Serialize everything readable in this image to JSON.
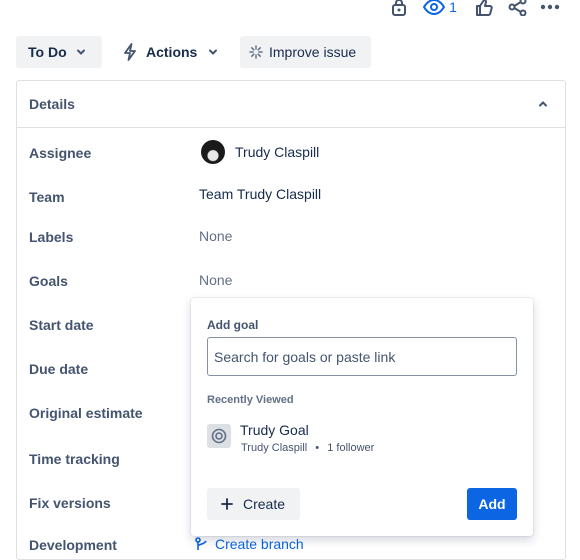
{
  "header": {
    "watch_count": "1",
    "icons": [
      "lock-icon",
      "watch-eye-icon",
      "like-icon",
      "share-icon",
      "more-icon"
    ]
  },
  "toolbar": {
    "status_label": "To Do",
    "actions_label": "Actions",
    "improve_label": "Improve issue"
  },
  "details": {
    "title": "Details",
    "fields": {
      "assignee": {
        "label": "Assignee",
        "value": "Trudy Claspill"
      },
      "team": {
        "label": "Team",
        "value": "Team Trudy Claspill"
      },
      "labels": {
        "label": "Labels",
        "value": "None"
      },
      "goals": {
        "label": "Goals",
        "value": "None"
      },
      "start_date": {
        "label": "Start date"
      },
      "due_date": {
        "label": "Due date"
      },
      "original_estimate": {
        "label": "Original estimate"
      },
      "time_tracking": {
        "label": "Time tracking"
      },
      "fix_versions": {
        "label": "Fix versions"
      },
      "development": {
        "label": "Development",
        "link": "Create branch"
      }
    }
  },
  "add_goal_popup": {
    "title": "Add goal",
    "search_placeholder": "Search for goals or paste link",
    "recent_heading": "Recently Viewed",
    "recent_goals": [
      {
        "name": "Trudy Goal",
        "owner": "Trudy Claspill",
        "separator": "•",
        "followers": "1 follower"
      }
    ],
    "create_label": "Create",
    "add_label": "Add"
  },
  "colors": {
    "accent": "#0c66e4",
    "button_grey": "#f1f2f4",
    "border": "#dcdfe4",
    "label_text": "#44546f"
  }
}
